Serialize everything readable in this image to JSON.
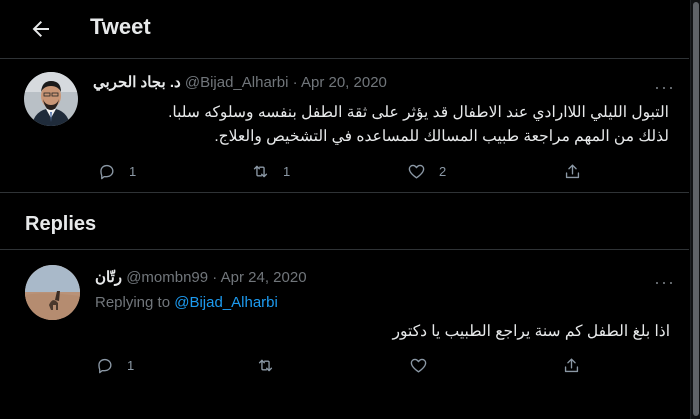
{
  "header": {
    "title": "Tweet",
    "back_icon": "arrow-left-icon"
  },
  "tweet": {
    "author_name": "د. بجاد الحربي",
    "handle": "@Bijad_Alharbi",
    "separator": "·",
    "date": "Apr 20, 2020",
    "text_line1": "التبول الليلي اللاارادي عند الاطفال قد يؤثر على ثقة الطفل بنفسه وسلوكه سلبا.",
    "text_line2": "لذلك من المهم مراجعة طبيب المسالك للمساعده في التشخيص والعلاج.",
    "more_label": "···",
    "actions": {
      "reply_count": "1",
      "retweet_count": "1",
      "like_count": "2"
    }
  },
  "replies_heading": "Replies",
  "reply": {
    "author_name": "رتّان",
    "handle": "@mombn99",
    "separator": "·",
    "date": "Apr 24, 2020",
    "replying_prefix": "Replying to",
    "replying_to": "@Bijad_Alharbi",
    "text": "اذا بلغ الطفل كم سنة يراجع الطبيب يا دكتور",
    "more_label": "···",
    "actions": {
      "reply_count": "1"
    }
  },
  "colors": {
    "background": "#000000",
    "text": "#e7e9ea",
    "muted": "#71767b",
    "link": "#1d9bf0",
    "divider": "#2f3336"
  }
}
